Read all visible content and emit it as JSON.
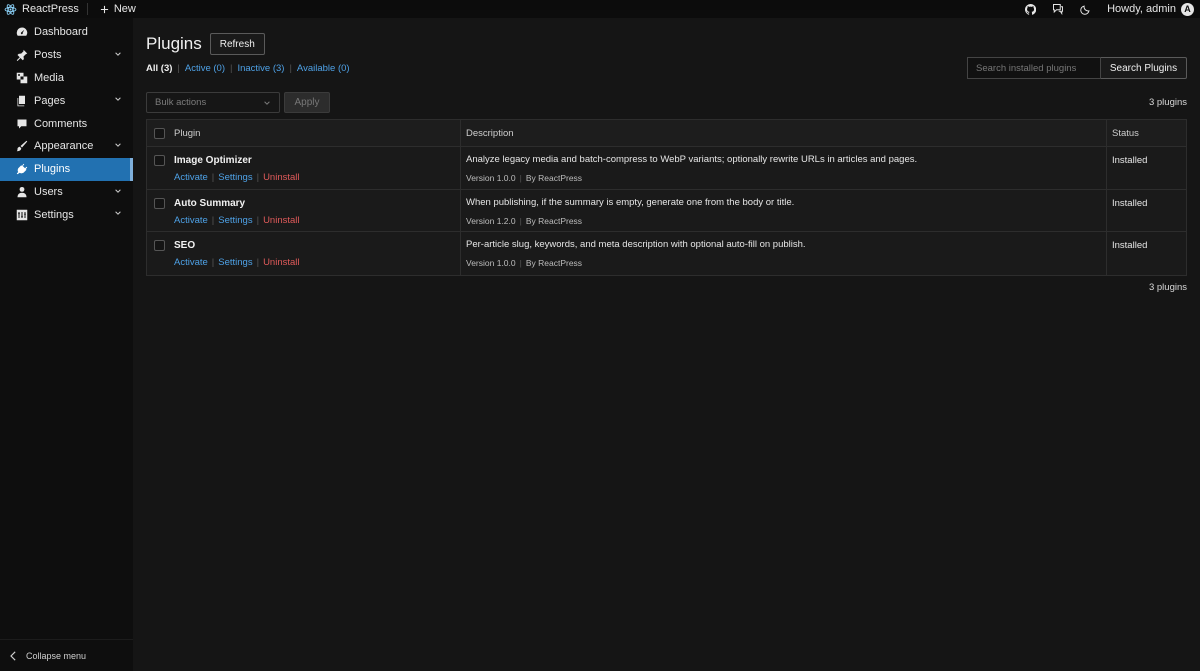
{
  "topbar": {
    "brand": "ReactPress",
    "new_label": "New",
    "howdy": "Howdy, admin",
    "avatar_letter": "A"
  },
  "sidebar": {
    "items": [
      {
        "label": "Dashboard",
        "icon": "dashboard-icon",
        "has_submenu": false
      },
      {
        "label": "Posts",
        "icon": "pin-icon",
        "has_submenu": true
      },
      {
        "label": "Media",
        "icon": "media-icon",
        "has_submenu": false
      },
      {
        "label": "Pages",
        "icon": "pages-icon",
        "has_submenu": true
      },
      {
        "label": "Comments",
        "icon": "comment-icon",
        "has_submenu": false
      },
      {
        "label": "Appearance",
        "icon": "brush-icon",
        "has_submenu": true
      },
      {
        "label": "Plugins",
        "icon": "plugin-icon",
        "has_submenu": false,
        "active": true
      },
      {
        "label": "Users",
        "icon": "user-icon",
        "has_submenu": true
      },
      {
        "label": "Settings",
        "icon": "settings-icon",
        "has_submenu": true
      }
    ],
    "collapse_label": "Collapse menu"
  },
  "page": {
    "title": "Plugins",
    "refresh_label": "Refresh",
    "filters": [
      {
        "label": "All (3)",
        "current": true
      },
      {
        "label": "Active (0)"
      },
      {
        "label": "Inactive (3)"
      },
      {
        "label": "Available (0)"
      }
    ],
    "search": {
      "placeholder": "Search installed plugins",
      "button": "Search Plugins"
    },
    "bulk": {
      "placeholder": "Bulk actions",
      "apply": "Apply"
    },
    "count_top": "3 plugins",
    "count_bottom": "3 plugins"
  },
  "table": {
    "headers": {
      "plugin": "Plugin",
      "description": "Description",
      "status": "Status"
    },
    "rows": [
      {
        "name": "Image Optimizer",
        "actions": {
          "activate": "Activate",
          "settings": "Settings",
          "uninstall": "Uninstall"
        },
        "description": "Analyze legacy media and batch-compress to WebP variants; optionally rewrite URLs in articles and pages.",
        "version": "Version 1.0.0",
        "author": "By ReactPress",
        "status": "Installed"
      },
      {
        "name": "Auto Summary",
        "actions": {
          "activate": "Activate",
          "settings": "Settings",
          "uninstall": "Uninstall"
        },
        "description": "When publishing, if the summary is empty, generate one from the body or title.",
        "version": "Version 1.2.0",
        "author": "By ReactPress",
        "status": "Installed"
      },
      {
        "name": "SEO",
        "actions": {
          "activate": "Activate",
          "settings": "Settings",
          "uninstall": "Uninstall"
        },
        "description": "Per-article slug, keywords, and meta description with optional auto-fill on publish.",
        "version": "Version 1.0.0",
        "author": "By ReactPress",
        "status": "Installed"
      }
    ]
  },
  "colors": {
    "accent": "#2271b1",
    "link": "#4ea1e6",
    "danger": "#e05a5a",
    "background": "#151515"
  }
}
